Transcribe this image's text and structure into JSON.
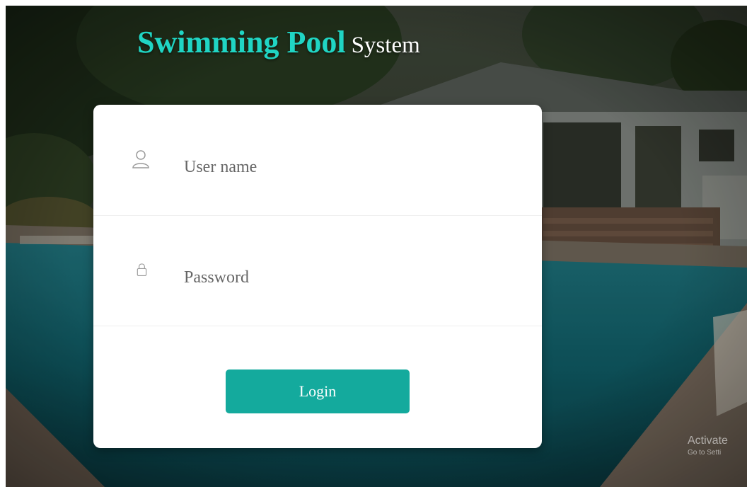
{
  "app": {
    "title_accent": "Swimming Pool",
    "title_rest": "System",
    "accent_color": "#20d5c4",
    "button_color": "#14aa9d"
  },
  "login_form": {
    "username": {
      "placeholder": "User name",
      "value": "",
      "icon": "user-icon"
    },
    "password": {
      "placeholder": "Password",
      "value": "",
      "icon": "lock-icon"
    },
    "login_label": "Login"
  },
  "watermark": {
    "title": "Activate",
    "subtitle": "Go to Setti"
  }
}
